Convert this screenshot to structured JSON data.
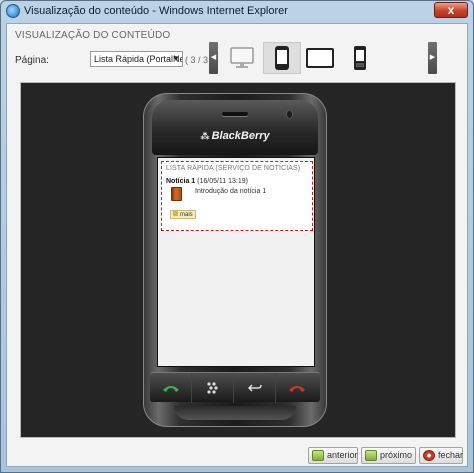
{
  "window": {
    "title": "Visualização do conteúdo - Windows Internet Explorer",
    "close_glyph": "x"
  },
  "panel": {
    "section_title": "VISUALIZAÇÃO DO CONTEÚDO",
    "page_label": "Página:",
    "page_select": {
      "value": "Lista Rápida (PortalNews)"
    },
    "page_count": "( 3 / 3 )"
  },
  "device_bar": {
    "devices": [
      {
        "name": "monitor-icon",
        "selected": false
      },
      {
        "name": "smartphone-icon",
        "selected": true
      },
      {
        "name": "widescreen-icon",
        "selected": false
      },
      {
        "name": "phone-icon",
        "selected": false
      }
    ]
  },
  "phone": {
    "brand": "BlackBerry"
  },
  "content": {
    "list_title": "LISTA RÁPIDA (SERVIÇO DE NOTÍCIAS)",
    "news_title": "Notícia 1",
    "news_date": "(16/05/11 13:19)",
    "news_description": "Introdução da notícia 1",
    "more_label": "mais"
  },
  "footer": {
    "prev_label": "anterior",
    "next_label": "próximo",
    "close_label": "fechar"
  }
}
